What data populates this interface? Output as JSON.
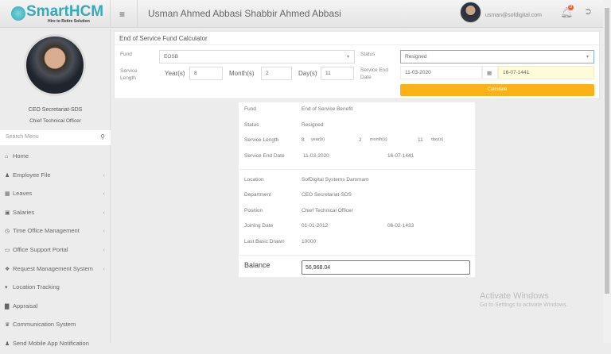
{
  "header": {
    "brand": "SmartHCM",
    "tagline": "Hire to Retire Solution",
    "user_name": "Usman Ahmed Abbasi Shabbir Ahmed Abbasi",
    "email": "usman@sofdigital.com",
    "notif_count": "0"
  },
  "sidebar": {
    "department": "CEO Secretariat-SDS",
    "position": "Chief Technical Officer",
    "search_placeholder": "Search Menu",
    "items": [
      {
        "label": "Home",
        "icon": "home-icon",
        "glyph": "⌂",
        "chev": false
      },
      {
        "label": "Employee File",
        "icon": "user-icon",
        "glyph": "♟",
        "chev": true
      },
      {
        "label": "Leaves",
        "icon": "calendar-icon",
        "glyph": "▦",
        "chev": true
      },
      {
        "label": "Salaries",
        "icon": "money-icon",
        "glyph": "▣",
        "chev": true
      },
      {
        "label": "Time Office Management",
        "icon": "clock-icon",
        "glyph": "◷",
        "chev": true
      },
      {
        "label": "Office Support Portal",
        "icon": "support-icon",
        "glyph": "▭",
        "chev": true
      },
      {
        "label": "Request Management System",
        "icon": "request-icon",
        "glyph": "❖",
        "chev": true
      },
      {
        "label": "Location Tracking",
        "icon": "map-marker-icon",
        "glyph": "▾",
        "chev": false
      },
      {
        "label": "Appraisal",
        "icon": "chart-icon",
        "glyph": "▇",
        "chev": false
      },
      {
        "label": "Communication System",
        "icon": "users-icon",
        "glyph": "♛",
        "chev": false
      },
      {
        "label": "Send Mobile App Notification",
        "icon": "mobile-icon",
        "glyph": "♟",
        "chev": false
      }
    ]
  },
  "calculator": {
    "title": "End of Service Fund Calculator",
    "fund_label": "Fund",
    "fund_value": "EOSB",
    "status_label": "Status",
    "status_value": "Resigned",
    "service_length_label": "Service Length",
    "years_label": "Year(s)",
    "years": "8",
    "months_label": "Month(s)",
    "months": "2",
    "days_label": "Day(s)",
    "days": "11",
    "end_date_label": "Service End Date",
    "end_date": "11-03-2020",
    "end_date_hijri": "16-07-1441",
    "calculate": "Calculate"
  },
  "result": {
    "fund_label": "Fund",
    "fund": "End of Service Benefit",
    "status_label": "Status",
    "status": "Resigned",
    "length_label": "Service Length",
    "years": "8",
    "years_unit": "year(s)",
    "months": "2",
    "months_unit": "month(s)",
    "days": "11",
    "days_unit": "day(s)",
    "end_label": "Service End Date",
    "end": "11-03-2020",
    "end_hijri": "16-07-1441",
    "location_label": "Location",
    "location": "SofDigital Systems Dammam",
    "department_label": "Department",
    "department": "CEO Secretariat-SDS",
    "position_label": "Position",
    "position": "Chief Technical Officer",
    "joining_label": "Joining Date",
    "joining": "01-01-2012",
    "joining_hijri": "06-02-1433",
    "basic_label": "Last Basic Drawn",
    "basic": "10000",
    "balance_label": "Balance",
    "balance": "56,968.04"
  },
  "watermark": {
    "title": "Activate Windows",
    "subtitle": "Go to Settings to activate Windows."
  }
}
